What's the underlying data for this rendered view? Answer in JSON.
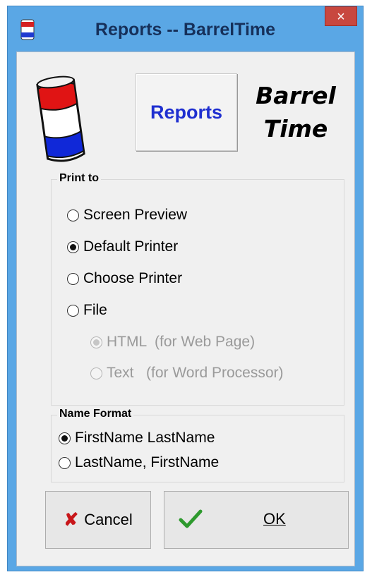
{
  "window": {
    "title": "Reports -- BarrelTime",
    "close_glyph": "×"
  },
  "header": {
    "reports_label": "Reports",
    "brand_line1": "Barrel",
    "brand_line2": "Time"
  },
  "print_to": {
    "legend": "Print to",
    "options": [
      {
        "label": "Screen Preview",
        "checked": false
      },
      {
        "label": "Default Printer",
        "checked": true
      },
      {
        "label": "Choose Printer",
        "checked": false
      },
      {
        "label": "File",
        "checked": false
      }
    ],
    "file_formats": [
      {
        "label": "HTML  (for Web Page)",
        "checked": true,
        "enabled": false
      },
      {
        "label": "Text   (for Word Processor)",
        "checked": false,
        "enabled": false
      }
    ]
  },
  "name_format": {
    "legend": "Name Format",
    "options": [
      {
        "label": "FirstName LastName",
        "checked": true
      },
      {
        "label": "LastName, FirstName",
        "checked": false
      }
    ]
  },
  "buttons": {
    "cancel_label": "Cancel",
    "ok_label": "OK",
    "cancel_icon": "x-icon",
    "ok_icon": "checkmark-icon"
  },
  "colors": {
    "titlebar": "#5aa7e5",
    "close": "#c8473f",
    "reports_text": "#1f2fd0",
    "cancel_x": "#c8161a",
    "ok_check": "#2e9a2e"
  }
}
